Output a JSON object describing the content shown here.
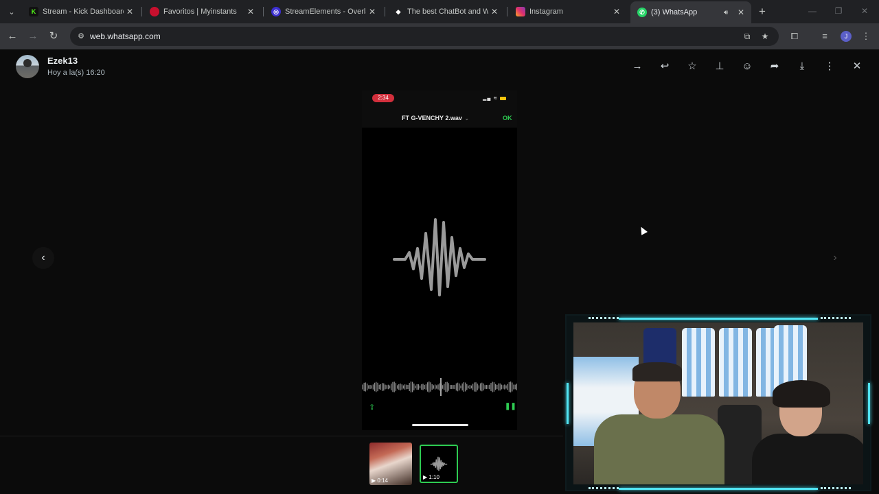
{
  "browser": {
    "tabs": [
      {
        "title": "Stream - Kick Dashboard",
        "favicon": "kick-icon",
        "color": "#53fc18"
      },
      {
        "title": "Favoritos | Myinstants",
        "favicon": "myinstants-icon",
        "color": "#c8102e"
      },
      {
        "title": "StreamElements - Overlays",
        "favicon": "streamelements-icon",
        "color": "#3b2ed0"
      },
      {
        "title": "The best ChatBot and Wid",
        "favicon": "chatbot-icon",
        "color": "#ffffff"
      },
      {
        "title": "Instagram",
        "favicon": "instagram-icon",
        "color": "#e1306c"
      },
      {
        "title": "(3) WhatsApp",
        "favicon": "whatsapp-icon",
        "color": "#25d366",
        "active": true
      }
    ],
    "url": "web.whatsapp.com",
    "profile_initial": "J"
  },
  "viewer": {
    "contact_name": "Ezek13",
    "timestamp": "Hoy a la(s) 16:20",
    "header_actions": [
      "forward-arrow-icon",
      "reply-icon",
      "star-icon",
      "pin-icon",
      "emoji-icon",
      "share-forward-icon",
      "download-icon",
      "more-options-icon",
      "close-icon"
    ]
  },
  "phone": {
    "clock": "2:34",
    "file_name": "FT G-VENCHY 2.wav",
    "ok_label": "OK"
  },
  "thumbnails": [
    {
      "duration": "0:14",
      "type": "video"
    },
    {
      "duration": "1:10",
      "type": "video",
      "selected": true
    }
  ],
  "colors": {
    "accent_green": "#2ecc52",
    "cam_glow": "#51e4f2",
    "background": "#0b0b0b"
  }
}
